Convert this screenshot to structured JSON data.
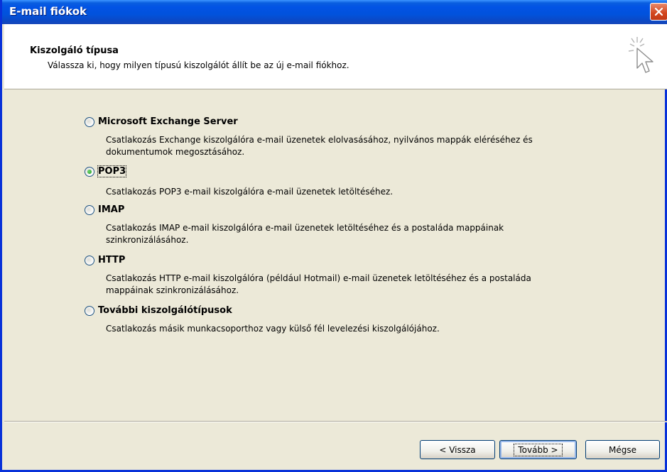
{
  "window": {
    "title": "E-mail fiókok"
  },
  "header": {
    "title": "Kiszolgáló típusa",
    "subtitle": "Válassza ki, hogy milyen típusú kiszolgálót állít be az új e-mail fiókhoz."
  },
  "options": [
    {
      "label": "Microsoft Exchange Server",
      "selected": false,
      "description": "Csatlakozás Exchange kiszolgálóra e-mail üzenetek elolvasásához, nyilvános mappák eléréséhez és dokumentumok megosztásához."
    },
    {
      "label": "POP3",
      "selected": true,
      "description": "Csatlakozás POP3 e-mail kiszolgálóra e-mail üzenetek letöltéséhez."
    },
    {
      "label": "IMAP",
      "selected": false,
      "description": "Csatlakozás IMAP e-mail kiszolgálóra e-mail üzenetek letöltéséhez és a postaláda mappáinak szinkronizálásához."
    },
    {
      "label": "HTTP",
      "selected": false,
      "description": "Csatlakozás HTTP e-mail kiszolgálóra (például Hotmail) e-mail üzenetek letöltéséhez és a postaláda mappáinak szinkronizálásához."
    },
    {
      "label": "További kiszolgálótípusok",
      "selected": false,
      "description": "Csatlakozás másik munkacsoporthoz vagy külső fél levelezési kiszolgálójához."
    }
  ],
  "buttons": {
    "back": "< Vissza",
    "next": "Tovább >",
    "cancel": "Mégse"
  },
  "icons": {
    "close": "close-icon",
    "wizard": "wizard-cursor-icon"
  },
  "colors": {
    "titlebar": "#0253e4",
    "body": "#ece9d8",
    "close": "#d2451d"
  }
}
